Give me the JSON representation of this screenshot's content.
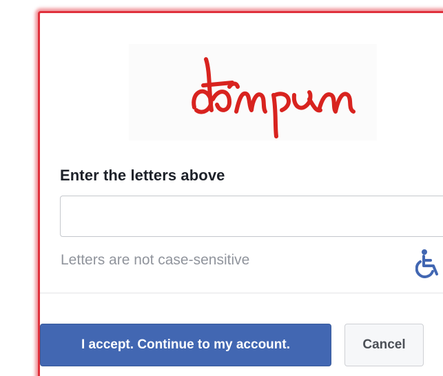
{
  "captcha": {
    "text": "akampum",
    "color": "#d8231f"
  },
  "form": {
    "label": "Enter the letters above",
    "input_value": "",
    "input_placeholder": "",
    "hint": "Letters are not case-sensitive",
    "accessibility_icon": "wheelchair-icon"
  },
  "actions": {
    "accept_label": "I accept. Continue to my account.",
    "cancel_label": "Cancel"
  },
  "colors": {
    "frame_highlight": "#e0303c",
    "primary_button": "#4267b2",
    "accessibility_icon": "#4267b2"
  }
}
